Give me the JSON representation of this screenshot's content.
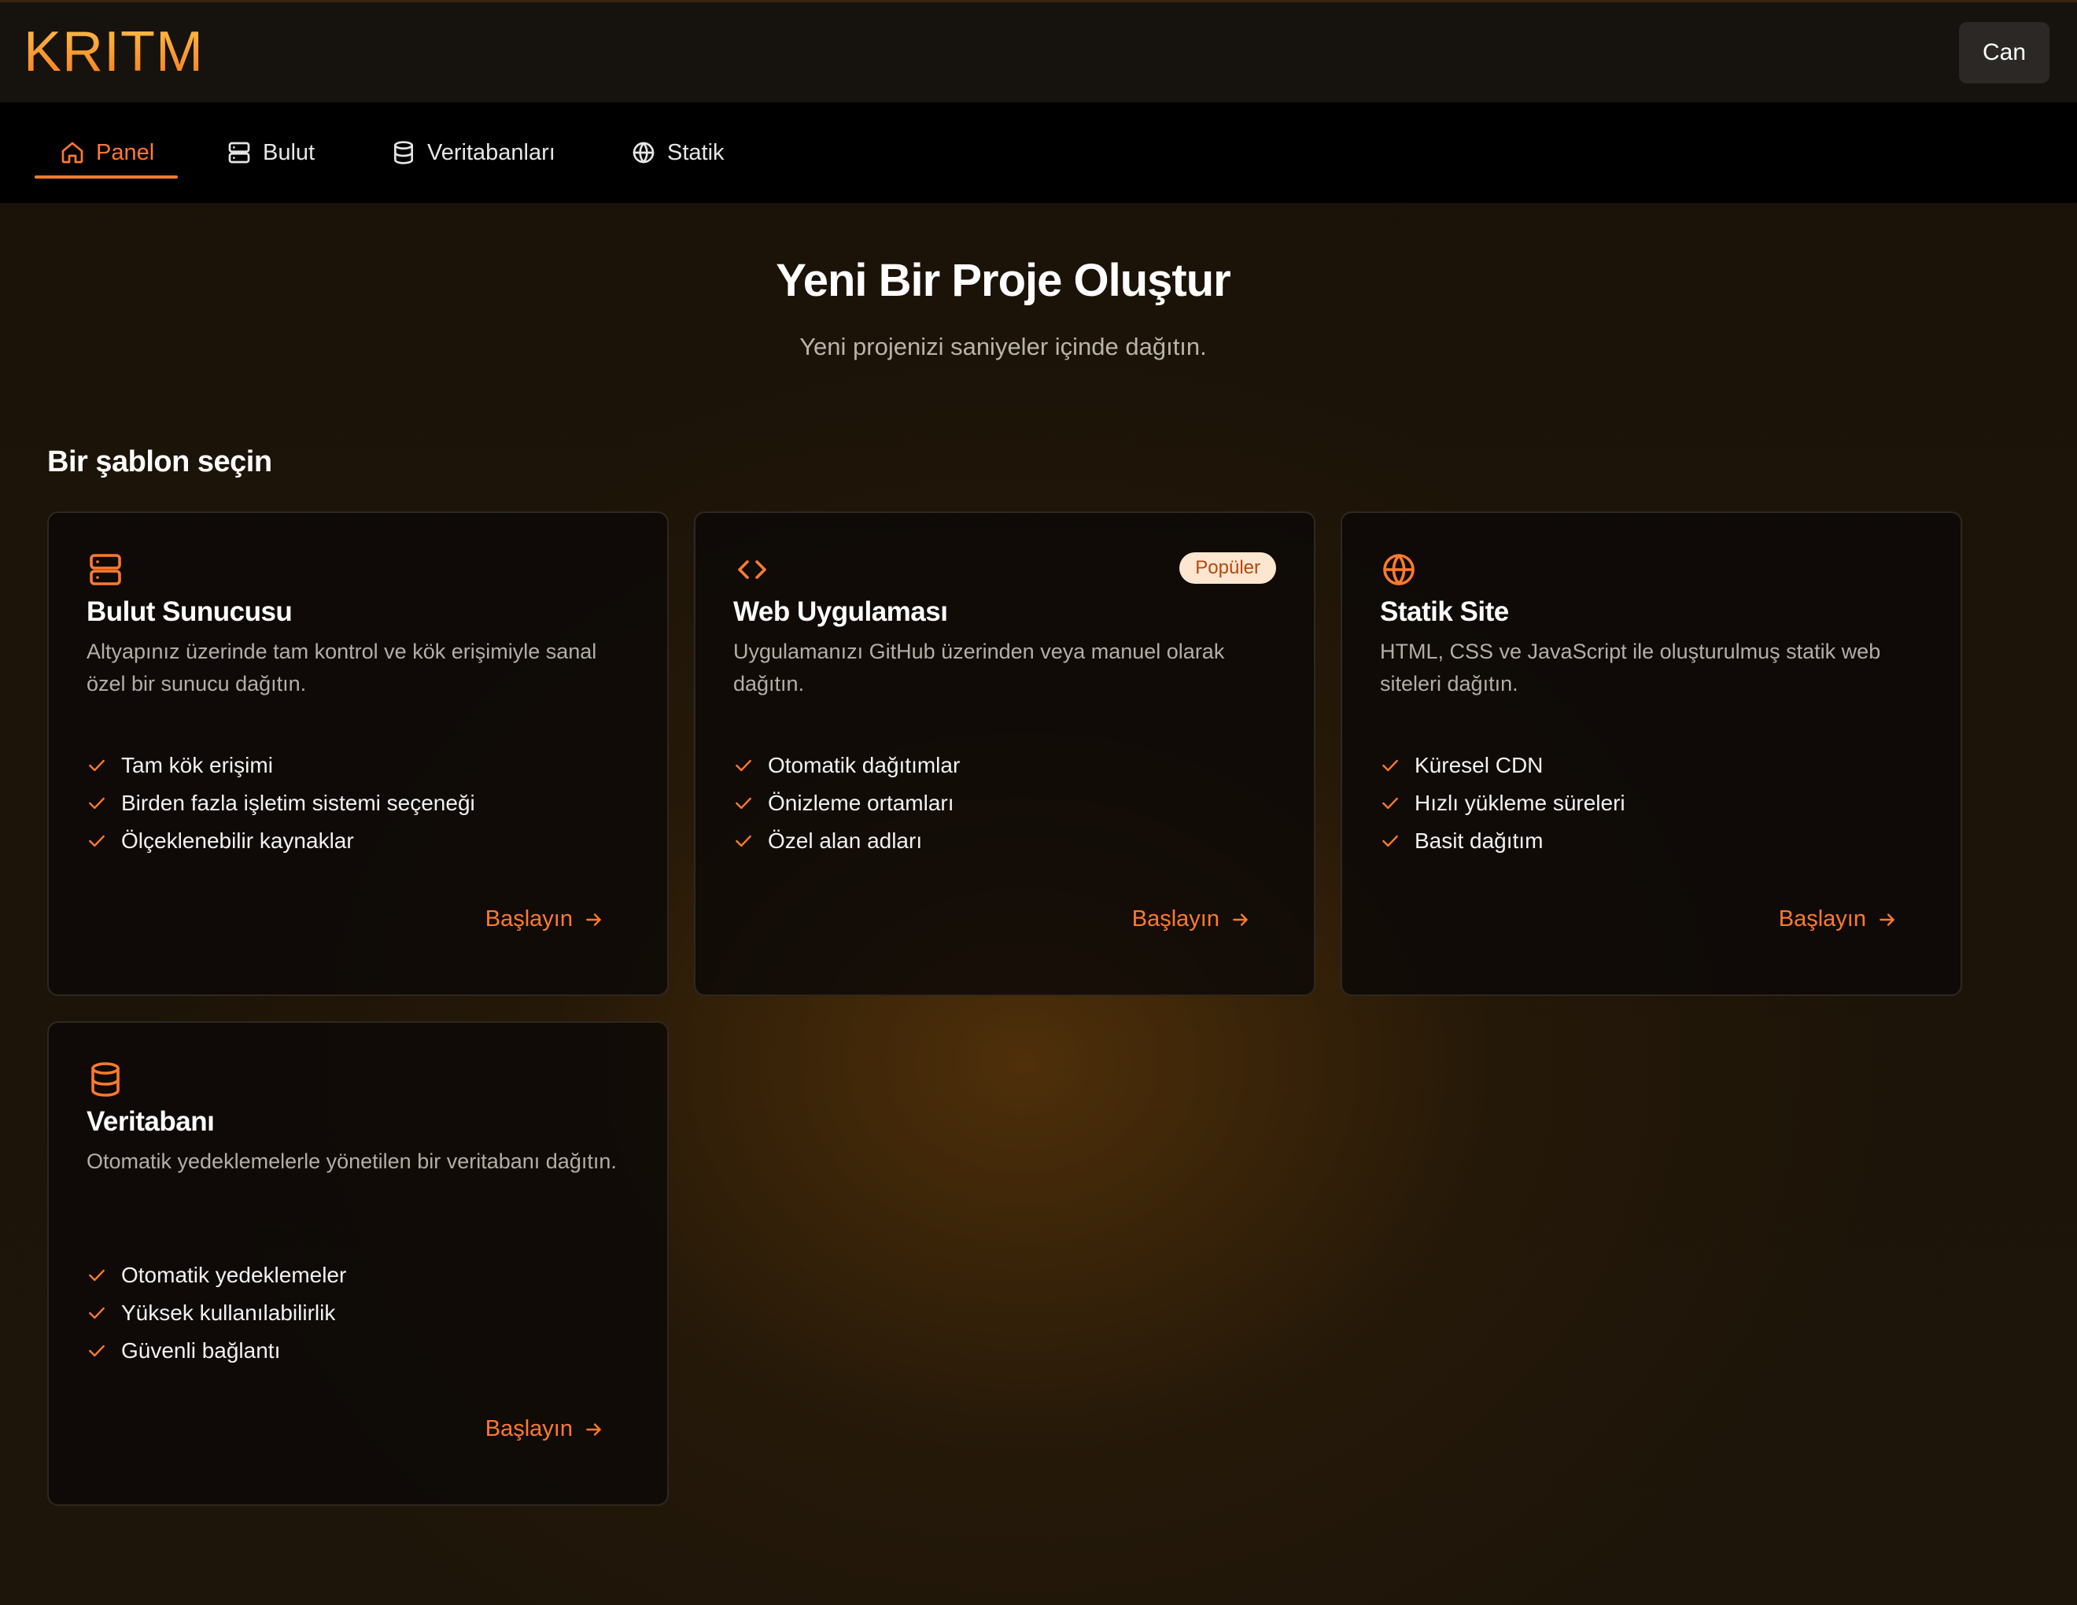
{
  "header": {
    "logo": "KRITM",
    "user_label": "Can"
  },
  "nav": {
    "tabs": [
      {
        "label": "Panel",
        "icon": "home-icon",
        "active": true
      },
      {
        "label": "Bulut",
        "icon": "server-icon",
        "active": false
      },
      {
        "label": "Veritabanları",
        "icon": "database-icon",
        "active": false
      },
      {
        "label": "Statik",
        "icon": "globe-icon",
        "active": false
      }
    ]
  },
  "hero": {
    "title": "Yeni Bir Proje Oluştur",
    "subtitle": "Yeni projenizi saniyeler içinde dağıtın."
  },
  "section_title": "Bir şablon seçin",
  "cards": [
    {
      "icon": "server-icon",
      "title": "Bulut Sunucusu",
      "description": "Altyapınız üzerinde tam kontrol ve kök erişimiyle sanal özel bir sunucu dağıtın.",
      "features": [
        "Tam kök erişimi",
        "Birden fazla işletim sistemi seçeneği",
        "Ölçeklenebilir kaynaklar"
      ],
      "cta": "Başlayın"
    },
    {
      "icon": "code-icon",
      "title": "Web Uygulaması",
      "badge": "Popüler",
      "description": "Uygulamanızı GitHub üzerinden veya manuel olarak dağıtın.",
      "features": [
        "Otomatik dağıtımlar",
        "Önizleme ortamları",
        "Özel alan adları"
      ],
      "cta": "Başlayın"
    },
    {
      "icon": "globe-icon",
      "title": "Statik Site",
      "description": "HTML, CSS ve JavaScript ile oluşturulmuş statik web siteleri dağıtın.",
      "features": [
        "Küresel CDN",
        "Hızlı yükleme süreleri",
        "Basit dağıtım"
      ],
      "cta": "Başlayın"
    },
    {
      "icon": "database-icon",
      "title": "Veritabanı",
      "description": "Otomatik yedeklemelerle yönetilen bir veritabanı dağıtın.",
      "features": [
        "Otomatik yedeklemeler",
        "Yüksek kullanılabilirlik",
        "Güvenli bağlantı"
      ],
      "cta": "Başlayın"
    }
  ],
  "colors": {
    "accent": "#ff7a2e",
    "badge_bg": "#fde6cf",
    "badge_text": "#b5470f",
    "logo_top": "#ffc04a",
    "logo_bottom": "#f57a1c"
  }
}
